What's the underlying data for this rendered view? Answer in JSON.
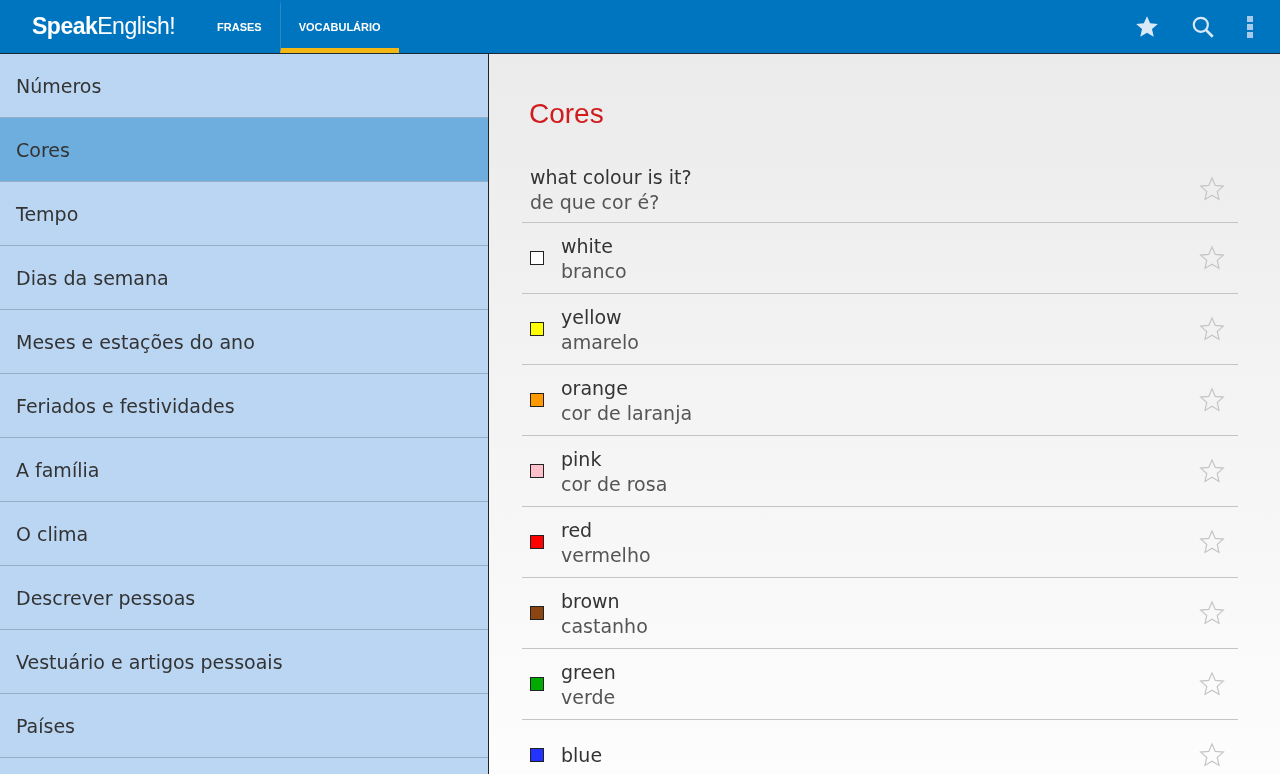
{
  "app_bar": {
    "logo": "**Speak**English!",
    "tabs": [
      {
        "label": "FRASES",
        "selected": false
      },
      {
        "label": "VOCABULÁRIO",
        "selected": true
      }
    ]
  },
  "sidebar": {
    "items": [
      {
        "label": "Números",
        "selected": false
      },
      {
        "label": "Cores",
        "selected": true
      },
      {
        "label": "Tempo",
        "selected": false
      },
      {
        "label": "Dias da semana",
        "selected": false
      },
      {
        "label": "Meses e estações do ano",
        "selected": false
      },
      {
        "label": "Feriados e festividades",
        "selected": false
      },
      {
        "label": "A família",
        "selected": false
      },
      {
        "label": "O clima",
        "selected": false
      },
      {
        "label": "Descrever pessoas",
        "selected": false
      },
      {
        "label": "Vestuário e artigos pessoais",
        "selected": false
      },
      {
        "label": "Países",
        "selected": false
      }
    ]
  },
  "content": {
    "title": "Cores",
    "entries": [
      {
        "kind": "phrase",
        "english": "what colour is it?",
        "portuguese": "de que cor é?",
        "starred": false
      },
      {
        "kind": "color",
        "color": "#ffffff",
        "english": "white",
        "portuguese": "branco",
        "starred": false
      },
      {
        "kind": "color",
        "color": "#ffff00",
        "english": "yellow",
        "portuguese": "amarelo",
        "starred": false
      },
      {
        "kind": "color",
        "color": "#ff9900",
        "english": "orange",
        "portuguese": "cor de laranja",
        "starred": false
      },
      {
        "kind": "color",
        "color": "#ffc0cb",
        "english": "pink",
        "portuguese": "cor de rosa",
        "starred": false
      },
      {
        "kind": "color",
        "color": "#ff0000",
        "english": "red",
        "portuguese": "vermelho",
        "starred": false
      },
      {
        "kind": "color",
        "color": "#8b4513",
        "english": "brown",
        "portuguese": "castanho",
        "starred": false
      },
      {
        "kind": "color",
        "color": "#00aa00",
        "english": "green",
        "portuguese": "verde",
        "starred": false
      },
      {
        "kind": "color",
        "color": "#2233ff",
        "english": "blue",
        "starred": false
      }
    ]
  }
}
